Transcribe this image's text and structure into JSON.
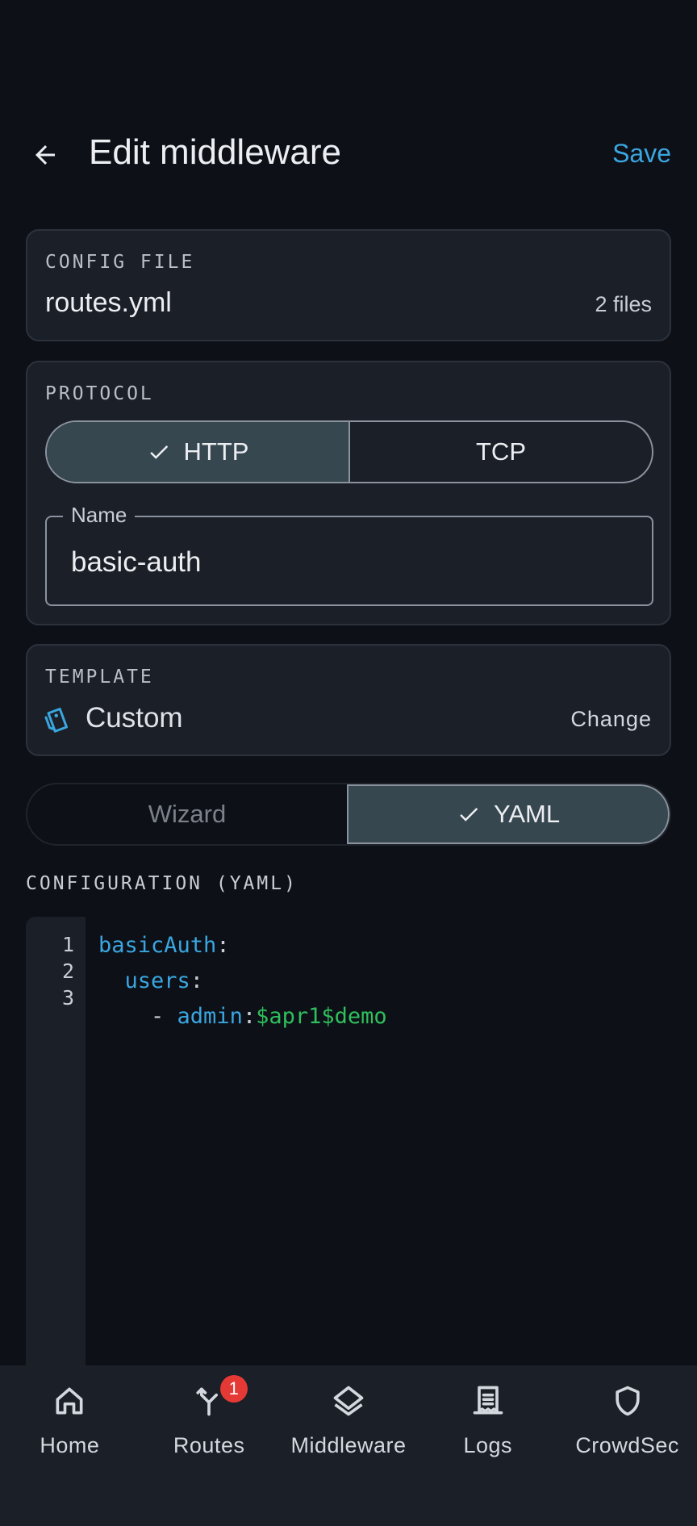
{
  "header": {
    "title": "Edit middleware",
    "save_label": "Save"
  },
  "config_file": {
    "label": "CONFIG FILE",
    "value": "routes.yml",
    "count": "2 files"
  },
  "protocol": {
    "label": "PROTOCOL",
    "options": [
      "HTTP",
      "TCP"
    ],
    "selected": "HTTP"
  },
  "name_field": {
    "label": "Name",
    "value": "basic-auth"
  },
  "template": {
    "label": "TEMPLATE",
    "value": "Custom",
    "change_label": "Change"
  },
  "mode": {
    "options": [
      "Wizard",
      "YAML"
    ],
    "selected": "YAML"
  },
  "editor": {
    "title": "CONFIGURATION (YAML)",
    "line_numbers": [
      "1",
      "2",
      "3"
    ],
    "lines": [
      {
        "indent": "",
        "dash": "",
        "key": "basicAuth",
        "sep": ":",
        "value": ""
      },
      {
        "indent": "  ",
        "dash": "",
        "key": "users",
        "sep": ":",
        "value": ""
      },
      {
        "indent": "    ",
        "dash": "- ",
        "key": "admin",
        "sep": ":",
        "value": "$apr1$demo"
      }
    ]
  },
  "nav": {
    "items": [
      {
        "label": "Home",
        "icon": "home-icon"
      },
      {
        "label": "Routes",
        "icon": "routes-icon",
        "badge": "1"
      },
      {
        "label": "Middleware",
        "icon": "layers-icon"
      },
      {
        "label": "Logs",
        "icon": "receipt-icon"
      },
      {
        "label": "CrowdSec",
        "icon": "shield-icon"
      }
    ]
  },
  "colors": {
    "background": "#0d1017",
    "card": "#1b1f27",
    "accent": "#3aa6e0",
    "string": "#2fbf5c",
    "selected": "#37474f",
    "badge": "#e53935"
  }
}
